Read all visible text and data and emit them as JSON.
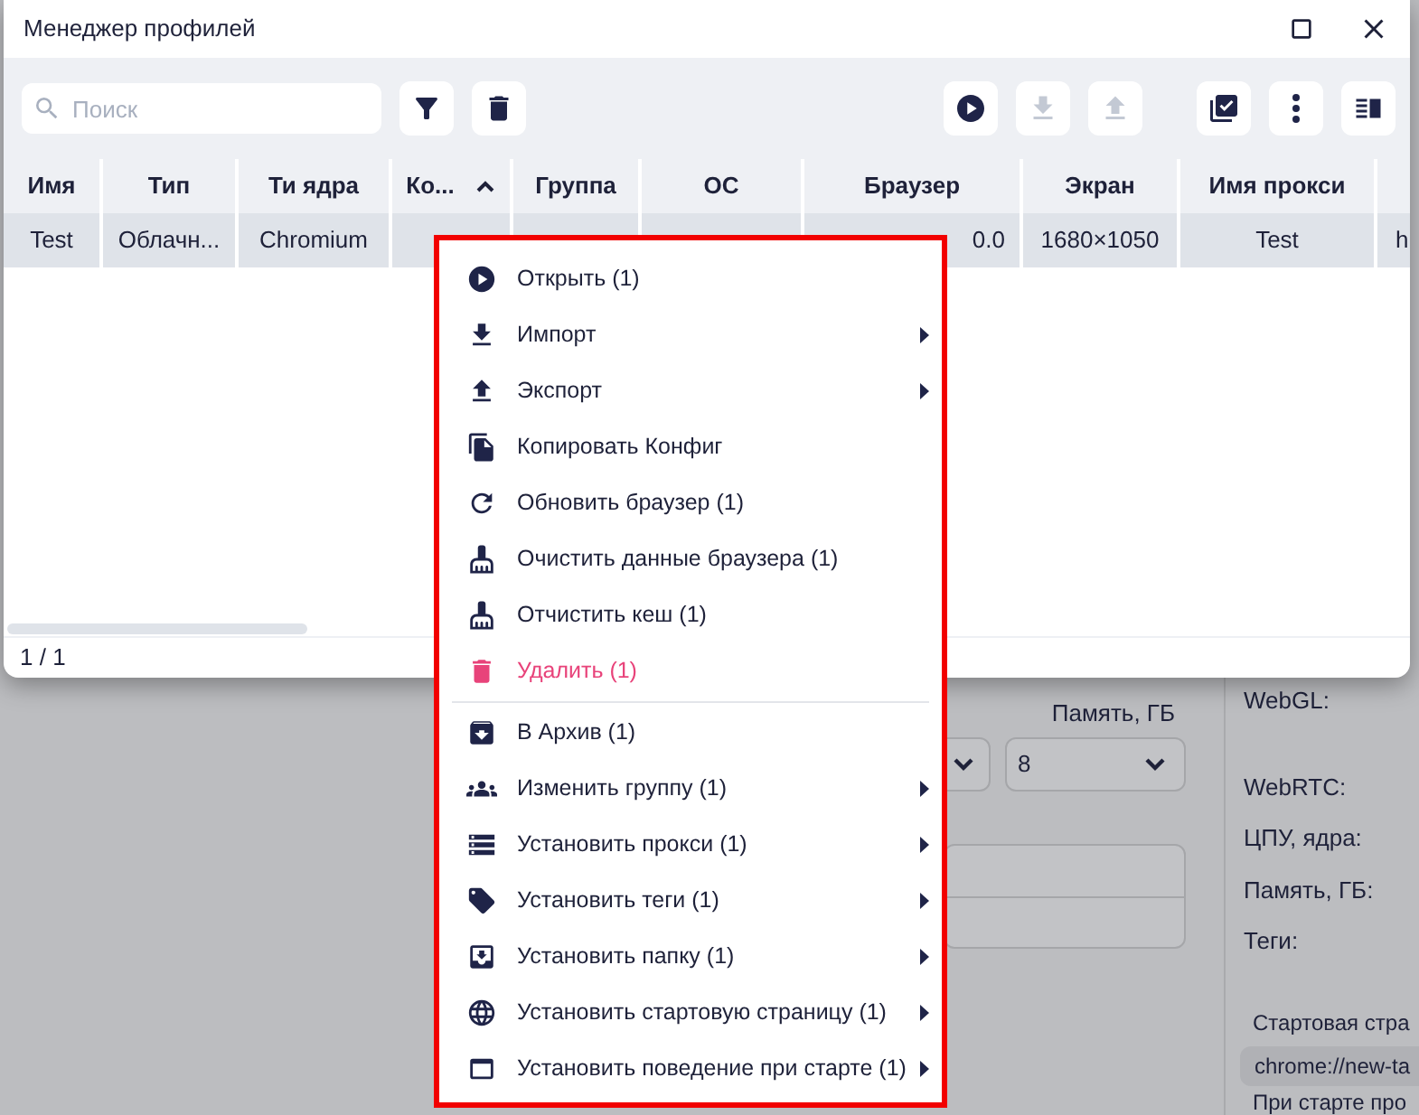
{
  "window": {
    "title": "Менеджер профилей"
  },
  "toolbar": {
    "search": {
      "placeholder": "Поиск"
    },
    "left_buttons": [
      {
        "disabled": false
      },
      {
        "disabled": false
      }
    ],
    "right_buttons": [
      {
        "disabled": false
      },
      {
        "disabled": true
      },
      {
        "disabled": true
      },
      {
        "disabled": false
      },
      {
        "disabled": false
      },
      {
        "disabled": false
      }
    ]
  },
  "table": {
    "columns": [
      {
        "label": "Имя",
        "sorted": false
      },
      {
        "label": "Тип",
        "sorted": false
      },
      {
        "label": "Ти ядра",
        "sorted": false
      },
      {
        "label": "Ко...",
        "sorted": true
      },
      {
        "label": "Группа",
        "sorted": false
      },
      {
        "label": "ОС",
        "sorted": false
      },
      {
        "label": "Браузер",
        "sorted": false
      },
      {
        "label": "Экран",
        "sorted": false
      },
      {
        "label": "Имя прокси",
        "sorted": false
      }
    ],
    "rows": [
      {
        "selected": true,
        "cells": {
          "name": "Test",
          "type": "Облачн...",
          "core": "Chromium",
          "browser": "0.0",
          "screen": "1680×1050",
          "proxy_name": "Test",
          "column_10": "h"
        }
      }
    ]
  },
  "status_bar": {
    "count": "1 / 1"
  },
  "context_menu": {
    "sections": [
      [
        {
          "label": "Открыть (1)",
          "submenu": false,
          "kind": "normal"
        },
        {
          "label": "Импорт",
          "submenu": true,
          "kind": "normal"
        },
        {
          "label": "Экспорт",
          "submenu": true,
          "kind": "normal"
        },
        {
          "label": "Копировать Конфиг",
          "submenu": false,
          "kind": "normal"
        },
        {
          "label": "Обновить браузер (1)",
          "submenu": false,
          "kind": "normal"
        },
        {
          "label": "Очистить данные браузера (1)",
          "submenu": false,
          "kind": "normal"
        },
        {
          "label": "Отчистить кеш (1)",
          "submenu": false,
          "kind": "normal"
        },
        {
          "label": "Удалить (1)",
          "submenu": false,
          "kind": "danger"
        }
      ],
      [
        {
          "label": "В Архив (1)",
          "submenu": false,
          "kind": "normal"
        },
        {
          "label": "Изменить группу (1)",
          "submenu": true,
          "kind": "normal"
        },
        {
          "label": "Установить прокси (1)",
          "submenu": true,
          "kind": "normal"
        },
        {
          "label": "Установить теги (1)",
          "submenu": true,
          "kind": "normal"
        },
        {
          "label": "Установить папку (1)",
          "submenu": true,
          "kind": "normal"
        },
        {
          "label": "Установить стартовую страницу (1)",
          "submenu": true,
          "kind": "normal"
        },
        {
          "label": "Установить поведение при старте (1)",
          "submenu": true,
          "kind": "normal"
        }
      ]
    ]
  },
  "background": {
    "memory_label": "Память, ГБ",
    "memory_value": "8",
    "info_labels": [
      "WebGL:",
      "WebRTC:",
      "ЦПУ, ядра:",
      "Память, ГБ:",
      "Теги:"
    ],
    "start_page_label": "Стартовая стра",
    "start_page_value": "chrome://new-ta",
    "startup_label": "При старте про"
  }
}
